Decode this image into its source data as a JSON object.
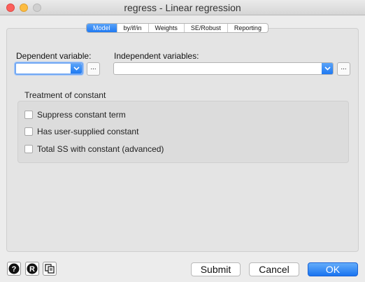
{
  "window": {
    "title": "regress - Linear regression"
  },
  "tabs": [
    {
      "label": "Model",
      "active": true
    },
    {
      "label": "by/if/in",
      "active": false
    },
    {
      "label": "Weights",
      "active": false
    },
    {
      "label": "SE/Robust",
      "active": false
    },
    {
      "label": "Reporting",
      "active": false
    }
  ],
  "model": {
    "dependent_label": "Dependent variable:",
    "dependent_value": "",
    "independent_label": "Independent variables:",
    "independent_value": "",
    "browse_label": "..."
  },
  "constant": {
    "title": "Treatment of constant",
    "options": [
      {
        "label": "Suppress constant term",
        "checked": false
      },
      {
        "label": "Has user-supplied constant",
        "checked": false
      },
      {
        "label": "Total SS with constant (advanced)",
        "checked": false
      }
    ]
  },
  "buttons": {
    "submit": "Submit",
    "cancel": "Cancel",
    "ok": "OK"
  },
  "colors": {
    "accent": "#1f79f2",
    "close": "#fc605c",
    "minimize": "#fdbc40"
  },
  "icons": [
    "help-icon",
    "r-icon",
    "copy-icon",
    "chevron-down-icon"
  ]
}
